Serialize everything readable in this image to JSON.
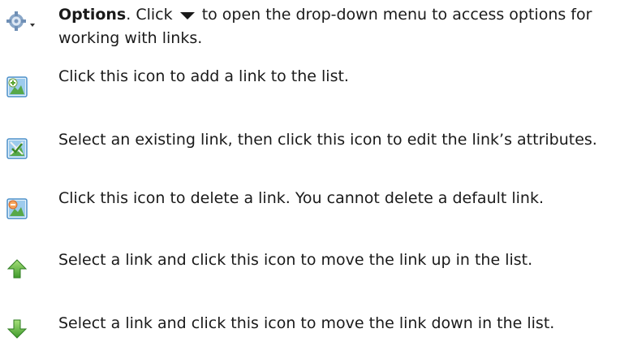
{
  "rows": [
    {
      "icon": "gear-dropdown-icon",
      "lead_bold": "Options",
      "lead_rest": ". Click",
      "inline_icon": "dropdown-arrow-icon",
      "text": " to open the drop-down menu to access options for working with links."
    },
    {
      "icon": "add-link-icon",
      "text": "Click this icon to add a link to the list."
    },
    {
      "icon": "edit-link-icon",
      "text": "Select an existing link, then click this icon to edit the link’s attributes."
    },
    {
      "icon": "delete-link-icon",
      "text": "Click this icon to delete a link. You cannot delete a default link."
    },
    {
      "icon": "move-up-icon",
      "text": "Select a link and click this icon to move the link up in the list."
    },
    {
      "icon": "move-down-icon",
      "text": "Select a link and click this icon to move the link down in the list."
    }
  ]
}
